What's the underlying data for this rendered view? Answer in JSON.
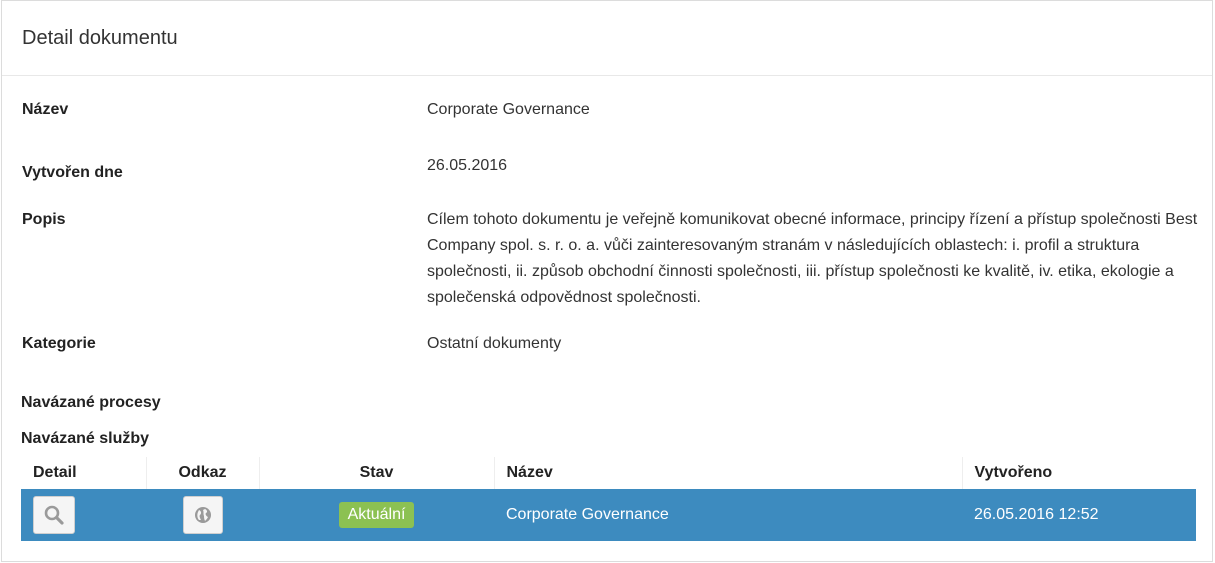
{
  "panel": {
    "title": "Detail dokumentu"
  },
  "fields": {
    "name": {
      "label": "Název",
      "value": "Corporate Governance"
    },
    "created": {
      "label": "Vytvořen dne",
      "value": "26.05.2016"
    },
    "description": {
      "label": "Popis",
      "value": "Cílem tohoto dokumentu je veřejně komunikovat obecné informace, principy řízení a přístup společnosti Best Company spol. s. r. o. a. vůči zainteresovaným stranám v následujících oblastech: i. profil a struktura společnosti, ii. způsob obchodní činnosti společnosti, iii. přístup společnosti ke kvalitě, iv. etika, ekologie a společenská odpovědnost společnosti."
    },
    "category": {
      "label": "Kategorie",
      "value": "Ostatní dokumenty"
    }
  },
  "sections": {
    "processes": "Navázané procesy",
    "services": "Navázané služby"
  },
  "table": {
    "columns": {
      "detail": "Detail",
      "link": "Odkaz",
      "status": "Stav",
      "name": "Název",
      "created": "Vytvořeno"
    },
    "rows": [
      {
        "status": "Aktuální",
        "name": "Corporate Governance",
        "created": "26.05.2016 12:52",
        "detail_icon": "search-icon",
        "link_icon": "globe-icon"
      }
    ]
  },
  "colors": {
    "selected_row": "#3d8bbf",
    "badge_ok": "#8cc152"
  }
}
